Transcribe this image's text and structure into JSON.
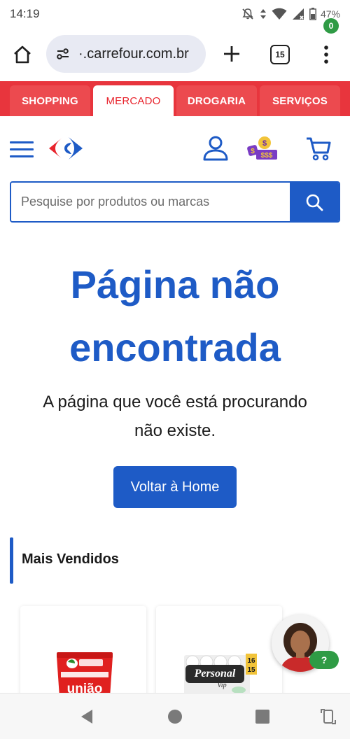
{
  "status_bar": {
    "time": "14:19",
    "battery_percent": "47%"
  },
  "browser": {
    "url_display": "·.carrefour.com.br",
    "tab_count": "15",
    "icons": [
      "home-icon",
      "site-settings-icon",
      "new-tab-icon",
      "tabs-icon",
      "more-menu-icon"
    ]
  },
  "category_tabs": [
    {
      "label": "SHOPPING",
      "active": false
    },
    {
      "label": "MERCADO",
      "active": true
    },
    {
      "label": "DROGARIA",
      "active": false
    },
    {
      "label": "SERVIÇOS",
      "active": false
    }
  ],
  "header": {
    "cart_count": "0",
    "icons": [
      "hamburger-menu-icon",
      "carrefour-logo",
      "user-icon",
      "promo-coins-icon",
      "cart-icon"
    ]
  },
  "search": {
    "placeholder": "Pesquise por produtos ou marcas",
    "value": ""
  },
  "error": {
    "title_line1": "Página não",
    "title_line2": "encontrada",
    "message_line1": "A página que você está procurando",
    "message_line2": "não existe.",
    "home_button": "Voltar à Home"
  },
  "section": {
    "title": "Mais Vendidos"
  },
  "products": [
    {
      "brand_text": "união"
    },
    {
      "brand_text": "Personal",
      "brand_sub": "Vip",
      "pack_top": "16",
      "pack_bottom": "15"
    }
  ],
  "chat": {
    "bubble": "?"
  },
  "colors": {
    "brand_blue": "#1e5bc6",
    "brand_red": "#e8353d",
    "badge_green": "#2f9b45"
  }
}
